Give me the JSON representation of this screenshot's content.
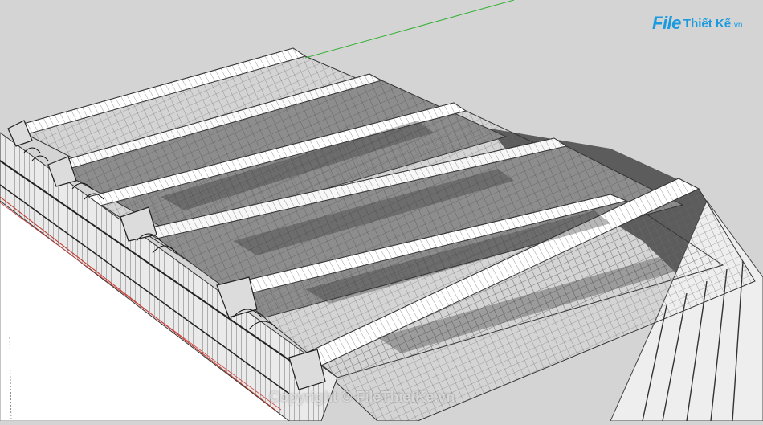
{
  "logo": {
    "file": "File",
    "rest": "Thiết Kế",
    "tld": ".vn"
  },
  "watermark": {
    "text": "Copyright © FileThietKe.vn"
  },
  "colors": {
    "background": "#d4d4d4",
    "ground": "#ffffff",
    "roof_light": "#f2f2f2",
    "roof_shade": "#9a9a9a",
    "shadow": "#5a5a5a",
    "axis_green": "#2fb02f",
    "axis_red": "#d04040",
    "logo_blue": "#1a9be0"
  },
  "icons": {
    "brand": "logo-icon"
  }
}
